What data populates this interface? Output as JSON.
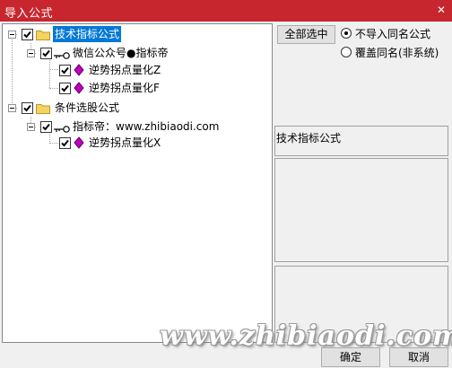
{
  "window": {
    "title": "导入公式"
  },
  "tree": {
    "nodes": [
      {
        "label": "技术指标公式"
      },
      {
        "label": "微信公众号●指标帝"
      },
      {
        "label": "逆势拐点量化Z"
      },
      {
        "label": "逆势拐点量化F"
      },
      {
        "label": "条件选股公式"
      },
      {
        "label": "指标帝：www.zhibiaodi.com"
      },
      {
        "label": "逆势拐点量化X"
      }
    ]
  },
  "options": {
    "select_all_label": "全部选中",
    "radio_skip_label": "不导入同名公式",
    "radio_overwrite_label": "覆盖同名(非系统)",
    "selected_radio": "不导入同名公式"
  },
  "detail": {
    "category_label": "技术指标公式"
  },
  "footer": {
    "ok_label": "确定",
    "cancel_label": "取消"
  },
  "watermark": {
    "text": "www.zhibiaodi.com"
  },
  "icons": {
    "folder": "folder-icon",
    "key": "key-icon",
    "formula": "formula-gem-icon",
    "checkbox": "checkbox-checked-icon",
    "close": "close-icon"
  },
  "colors": {
    "titlebar": "#c8262e",
    "selection": "#0078d7",
    "gem": "#c000c0",
    "folder": "#f4d35e"
  }
}
